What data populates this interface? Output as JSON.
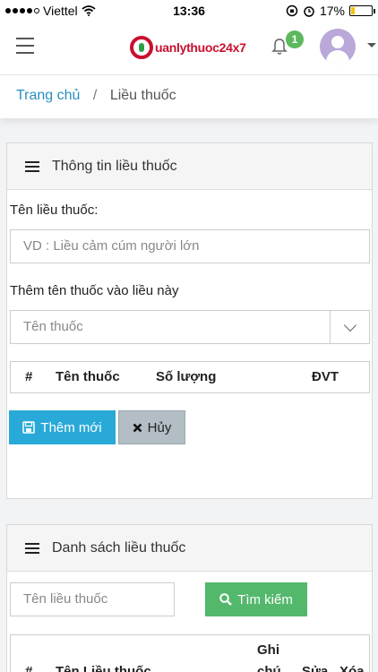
{
  "status_bar": {
    "carrier": "Viettel",
    "time": "13:36",
    "battery": "17%",
    "battery_level": 0.17
  },
  "header": {
    "menu_icon": "hamburger-icon",
    "logo_text": "uanlythuoc24x7",
    "notification_icon": "bell-icon",
    "notification_count": "1",
    "avatar_icon": "user-avatar",
    "dropdown_icon": "caret-down-icon",
    "colors": {
      "logo_red": "#c8102e",
      "badge_green": "#5cb85c"
    }
  },
  "breadcrumb": {
    "home": "Trang chủ",
    "separator": "/",
    "current": "Liều thuốc"
  },
  "form_panel": {
    "title": "Thông tin liều thuốc",
    "name_label": "Tên liều thuốc:",
    "name_placeholder": "VD : Liều cảm cúm người lớn",
    "add_drug_label": "Thêm tên thuốc vào liều này",
    "drug_select_value": "Tên thuốc",
    "table_headers": [
      "#",
      "Tên thuốc",
      "Số lượng",
      "ĐVT"
    ],
    "add_button": "Thêm mới",
    "cancel_button": "Hủy"
  },
  "list_panel": {
    "title": "Danh sách liều thuốc",
    "search_placeholder": "Tên liều thuốc",
    "search_button": "Tìm kiếm",
    "table_headers": [
      "#",
      "Tên Liều thuốc",
      "Ghi",
      "chú",
      "Sửa",
      "Xóa"
    ]
  },
  "colors": {
    "primary": "#29a9d8",
    "success": "#53b86c",
    "link": "#2a8fbd"
  }
}
